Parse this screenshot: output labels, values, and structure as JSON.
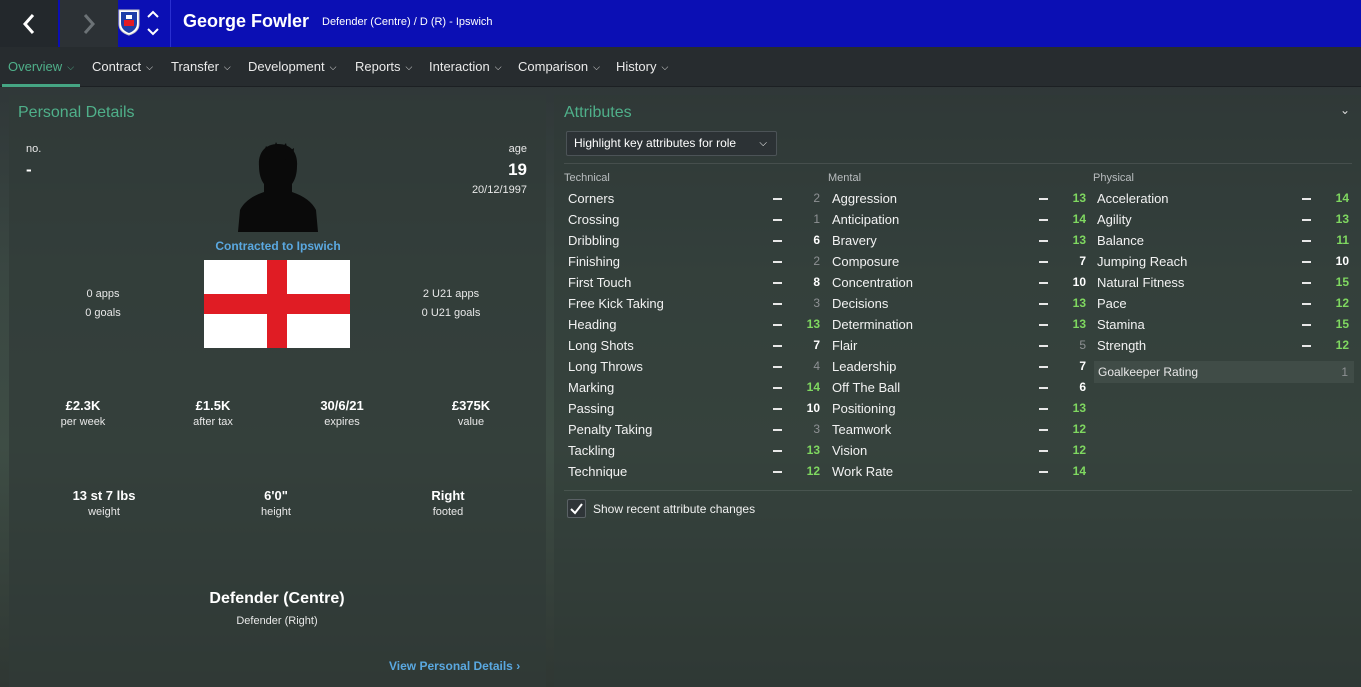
{
  "header": {
    "player_name": "George Fowler",
    "player_subtitle": "Defender (Centre) / D (R) - Ipswich",
    "bar_color": "#0b0fb4"
  },
  "tabs": [
    {
      "label": "Overview",
      "active": true
    },
    {
      "label": "Contract"
    },
    {
      "label": "Transfer"
    },
    {
      "label": "Development"
    },
    {
      "label": "Reports"
    },
    {
      "label": "Interaction"
    },
    {
      "label": "Comparison"
    },
    {
      "label": "History"
    }
  ],
  "personal": {
    "title": "Personal Details",
    "no_label": "no.",
    "no_value": "-",
    "age_label": "age",
    "age_value": "19",
    "dob": "20/12/1997",
    "contracted": "Contracted to Ipswich",
    "apps": "0 apps",
    "goals": "0 goals",
    "u21_apps": "2 U21 apps",
    "u21_goals": "0 U21 goals",
    "nationality_flag": "england-flag",
    "wage": {
      "value": "£2.3K",
      "label": "per week"
    },
    "after_tax": {
      "value": "£1.5K",
      "label": "after tax"
    },
    "expires": {
      "value": "30/6/21",
      "label": "expires"
    },
    "player_value": {
      "value": "£375K",
      "label": "value"
    },
    "weight": {
      "value": "13 st 7 lbs",
      "label": "weight"
    },
    "height": {
      "value": "6'0\"",
      "label": "height"
    },
    "footed": {
      "value": "Right",
      "label": "footed"
    },
    "position_main": "Defender (Centre)",
    "position_sub": "Defender (Right)",
    "link": "View Personal Details"
  },
  "attributes": {
    "title": "Attributes",
    "dropdown": "Highlight key attributes for role",
    "technical_label": "Technical",
    "mental_label": "Mental",
    "physical_label": "Physical",
    "technical": [
      {
        "name": "Corners",
        "value": "2",
        "highlight": "low"
      },
      {
        "name": "Crossing",
        "value": "1",
        "highlight": "low"
      },
      {
        "name": "Dribbling",
        "value": "6",
        "highlight": "mid"
      },
      {
        "name": "Finishing",
        "value": "2",
        "highlight": "low"
      },
      {
        "name": "First Touch",
        "value": "8",
        "highlight": "mid"
      },
      {
        "name": "Free Kick Taking",
        "value": "3",
        "highlight": "low"
      },
      {
        "name": "Heading",
        "value": "13",
        "highlight": "high"
      },
      {
        "name": "Long Shots",
        "value": "7",
        "highlight": "mid"
      },
      {
        "name": "Long Throws",
        "value": "4",
        "highlight": "low"
      },
      {
        "name": "Marking",
        "value": "14",
        "highlight": "high"
      },
      {
        "name": "Passing",
        "value": "10",
        "highlight": "mid"
      },
      {
        "name": "Penalty Taking",
        "value": "3",
        "highlight": "low"
      },
      {
        "name": "Tackling",
        "value": "13",
        "highlight": "high"
      },
      {
        "name": "Technique",
        "value": "12",
        "highlight": "high"
      }
    ],
    "mental": [
      {
        "name": "Aggression",
        "value": "13",
        "highlight": "high"
      },
      {
        "name": "Anticipation",
        "value": "14",
        "highlight": "high"
      },
      {
        "name": "Bravery",
        "value": "13",
        "highlight": "high"
      },
      {
        "name": "Composure",
        "value": "7",
        "highlight": "mid"
      },
      {
        "name": "Concentration",
        "value": "10",
        "highlight": "mid"
      },
      {
        "name": "Decisions",
        "value": "13",
        "highlight": "high"
      },
      {
        "name": "Determination",
        "value": "13",
        "highlight": "high"
      },
      {
        "name": "Flair",
        "value": "5",
        "highlight": "low"
      },
      {
        "name": "Leadership",
        "value": "7",
        "highlight": "mid"
      },
      {
        "name": "Off The Ball",
        "value": "6",
        "highlight": "mid"
      },
      {
        "name": "Positioning",
        "value": "13",
        "highlight": "high"
      },
      {
        "name": "Teamwork",
        "value": "12",
        "highlight": "high"
      },
      {
        "name": "Vision",
        "value": "12",
        "highlight": "high"
      },
      {
        "name": "Work Rate",
        "value": "14",
        "highlight": "high"
      }
    ],
    "physical": [
      {
        "name": "Acceleration",
        "value": "14",
        "highlight": "high"
      },
      {
        "name": "Agility",
        "value": "13",
        "highlight": "high"
      },
      {
        "name": "Balance",
        "value": "11",
        "highlight": "high"
      },
      {
        "name": "Jumping Reach",
        "value": "10",
        "highlight": "mid"
      },
      {
        "name": "Natural Fitness",
        "value": "15",
        "highlight": "high"
      },
      {
        "name": "Pace",
        "value": "12",
        "highlight": "high"
      },
      {
        "name": "Stamina",
        "value": "15",
        "highlight": "high"
      },
      {
        "name": "Strength",
        "value": "12",
        "highlight": "high"
      }
    ],
    "goalkeeper_rating_label": "Goalkeeper Rating",
    "goalkeeper_rating_value": "1",
    "show_changes_label": "Show recent attribute changes",
    "show_changes_checked": true
  }
}
